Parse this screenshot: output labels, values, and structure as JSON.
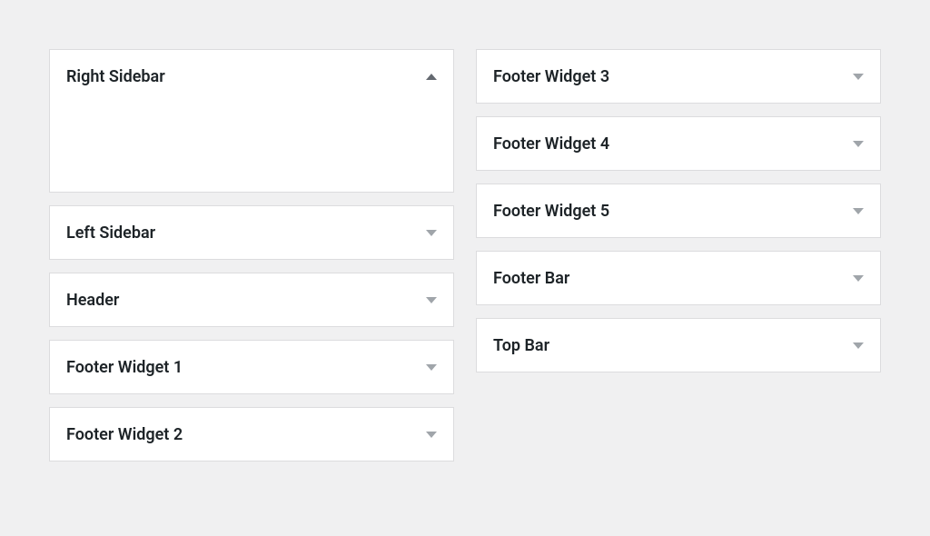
{
  "columns": {
    "left": [
      {
        "label": "Right Sidebar",
        "expanded": true
      },
      {
        "label": "Left Sidebar",
        "expanded": false
      },
      {
        "label": "Header",
        "expanded": false
      },
      {
        "label": "Footer Widget 1",
        "expanded": false
      },
      {
        "label": "Footer Widget 2",
        "expanded": false
      }
    ],
    "right": [
      {
        "label": "Footer Widget 3",
        "expanded": false
      },
      {
        "label": "Footer Widget 4",
        "expanded": false
      },
      {
        "label": "Footer Widget 5",
        "expanded": false
      },
      {
        "label": "Footer Bar",
        "expanded": false
      },
      {
        "label": "Top Bar",
        "expanded": false
      }
    ]
  }
}
